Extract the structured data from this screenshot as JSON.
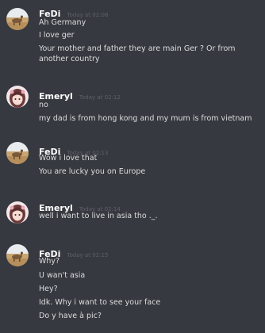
{
  "messages": [
    {
      "username": "FeDi",
      "timestamp": "Today at 02:08",
      "lines": [
        "Ah Germany",
        "I love ger",
        "Your mother and father they are main Ger ? Or from",
        "another country"
      ]
    },
    {
      "username": "Emeryl",
      "timestamp": "Today at 02:12",
      "lines": [
        "no",
        "my dad is from hong kong and my mum is from vietnam"
      ]
    },
    {
      "username": "FeDi",
      "timestamp": "Today at 02:13",
      "lines": [
        "Wow i love that",
        "You are lucky you on Europe"
      ]
    },
    {
      "username": "Emeryl",
      "timestamp": "Today at 02:14",
      "lines": [
        "well i want to live in asia tho ._."
      ]
    },
    {
      "username": "FeDi",
      "timestamp": "Today at 02:15",
      "lines": [
        "Why?",
        "U wan't asia",
        "Hey?",
        "Idk. Why i want to see your face",
        "Do y have à pic?"
      ]
    }
  ]
}
